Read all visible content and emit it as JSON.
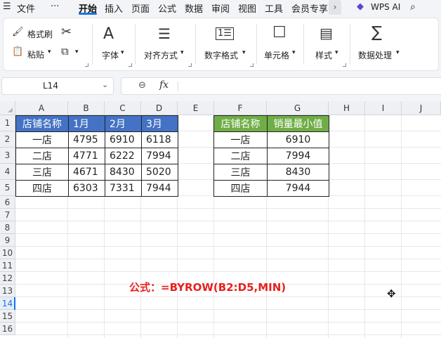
{
  "menu": {
    "items": [
      "文件",
      "···",
      "开始",
      "插入",
      "页面",
      "公式",
      "数据",
      "审阅",
      "视图",
      "工具",
      "会员专享"
    ],
    "active": "开始",
    "more": "›",
    "wps_ai": "WPS AI"
  },
  "ribbon": {
    "format_painter": "格式刷",
    "paste": "粘贴",
    "font": "字体",
    "align": "对齐方式",
    "number_format": "数字格式",
    "cell": "单元格",
    "style": "样式",
    "data_process": "数据处理",
    "icons": {
      "font": "A",
      "align": "☰",
      "number": "1☰",
      "cell": "☐",
      "style": "▤",
      "sum": "∑",
      "cut": "✂",
      "copy": "⧉"
    }
  },
  "formula_bar": {
    "cell_ref": "L14",
    "fx": "fx"
  },
  "columns": [
    "A",
    "B",
    "C",
    "D",
    "E",
    "F",
    "G",
    "H",
    "I",
    "J"
  ],
  "rows": [
    "1",
    "2",
    "3",
    "4",
    "5",
    "6",
    "7",
    "8",
    "9",
    "10",
    "11",
    "12",
    "13",
    "14",
    "15",
    "16"
  ],
  "selected_row": "14",
  "table1": {
    "header": [
      "店铺名称",
      "1月",
      "2月",
      "3月"
    ],
    "rows": [
      [
        "一店",
        "4795",
        "6910",
        "6118"
      ],
      [
        "二店",
        "4771",
        "6222",
        "7994"
      ],
      [
        "三店",
        "4671",
        "8430",
        "5020"
      ],
      [
        "四店",
        "6303",
        "7331",
        "7944"
      ]
    ]
  },
  "table2": {
    "header": [
      "店铺名称",
      "销量最小值"
    ],
    "rows": [
      [
        "一店",
        "6910"
      ],
      [
        "二店",
        "7994"
      ],
      [
        "三店",
        "8430"
      ],
      [
        "四店",
        "7944"
      ]
    ]
  },
  "note": "公式：=BYROW(B2:D5,MIN)",
  "colors": {
    "table1_header": "#4472c4",
    "table2_header": "#70ad47",
    "note": "#e8201c",
    "accent": "#1a73e8"
  }
}
